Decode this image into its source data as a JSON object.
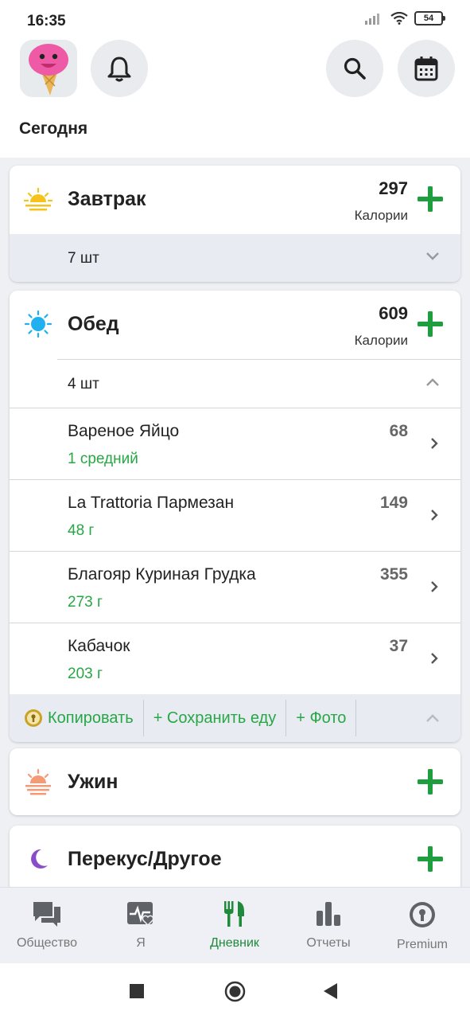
{
  "status": {
    "time": "16:35",
    "battery": "54"
  },
  "header": {
    "section_title": "Сегодня"
  },
  "meals": [
    {
      "title": "Завтрак",
      "calories": "297",
      "calories_label": "Калории",
      "count": "7 шт"
    },
    {
      "title": "Обед",
      "calories": "609",
      "calories_label": "Калории",
      "count": "4 шт",
      "items": [
        {
          "name": "Вареное Яйцо",
          "amount": "1 средний",
          "calories": "68"
        },
        {
          "name": "La Trattoria Пармезан",
          "amount": "48 г",
          "calories": "149"
        },
        {
          "name": "Благояр Куриная Грудка",
          "amount": "273 г",
          "calories": "355"
        },
        {
          "name": "Кабачок",
          "amount": "203 г",
          "calories": "37"
        }
      ],
      "actions": {
        "copy": "Копировать",
        "save": "+ Сохранить еду",
        "photo": "+ Фото"
      }
    },
    {
      "title": "Ужин"
    },
    {
      "title": "Перекус/Другое"
    }
  ],
  "nav": [
    {
      "label": "Общество",
      "icon": "chat-icon"
    },
    {
      "label": "Я",
      "icon": "health-icon"
    },
    {
      "label": "Дневник",
      "icon": "utensils-icon",
      "active": true
    },
    {
      "label": "Отчеты",
      "icon": "bar-chart-icon"
    },
    {
      "label": "Premium",
      "icon": "premium-badge-icon"
    }
  ],
  "colors": {
    "accent": "#27a745",
    "active_nav": "#1e8a3a"
  }
}
